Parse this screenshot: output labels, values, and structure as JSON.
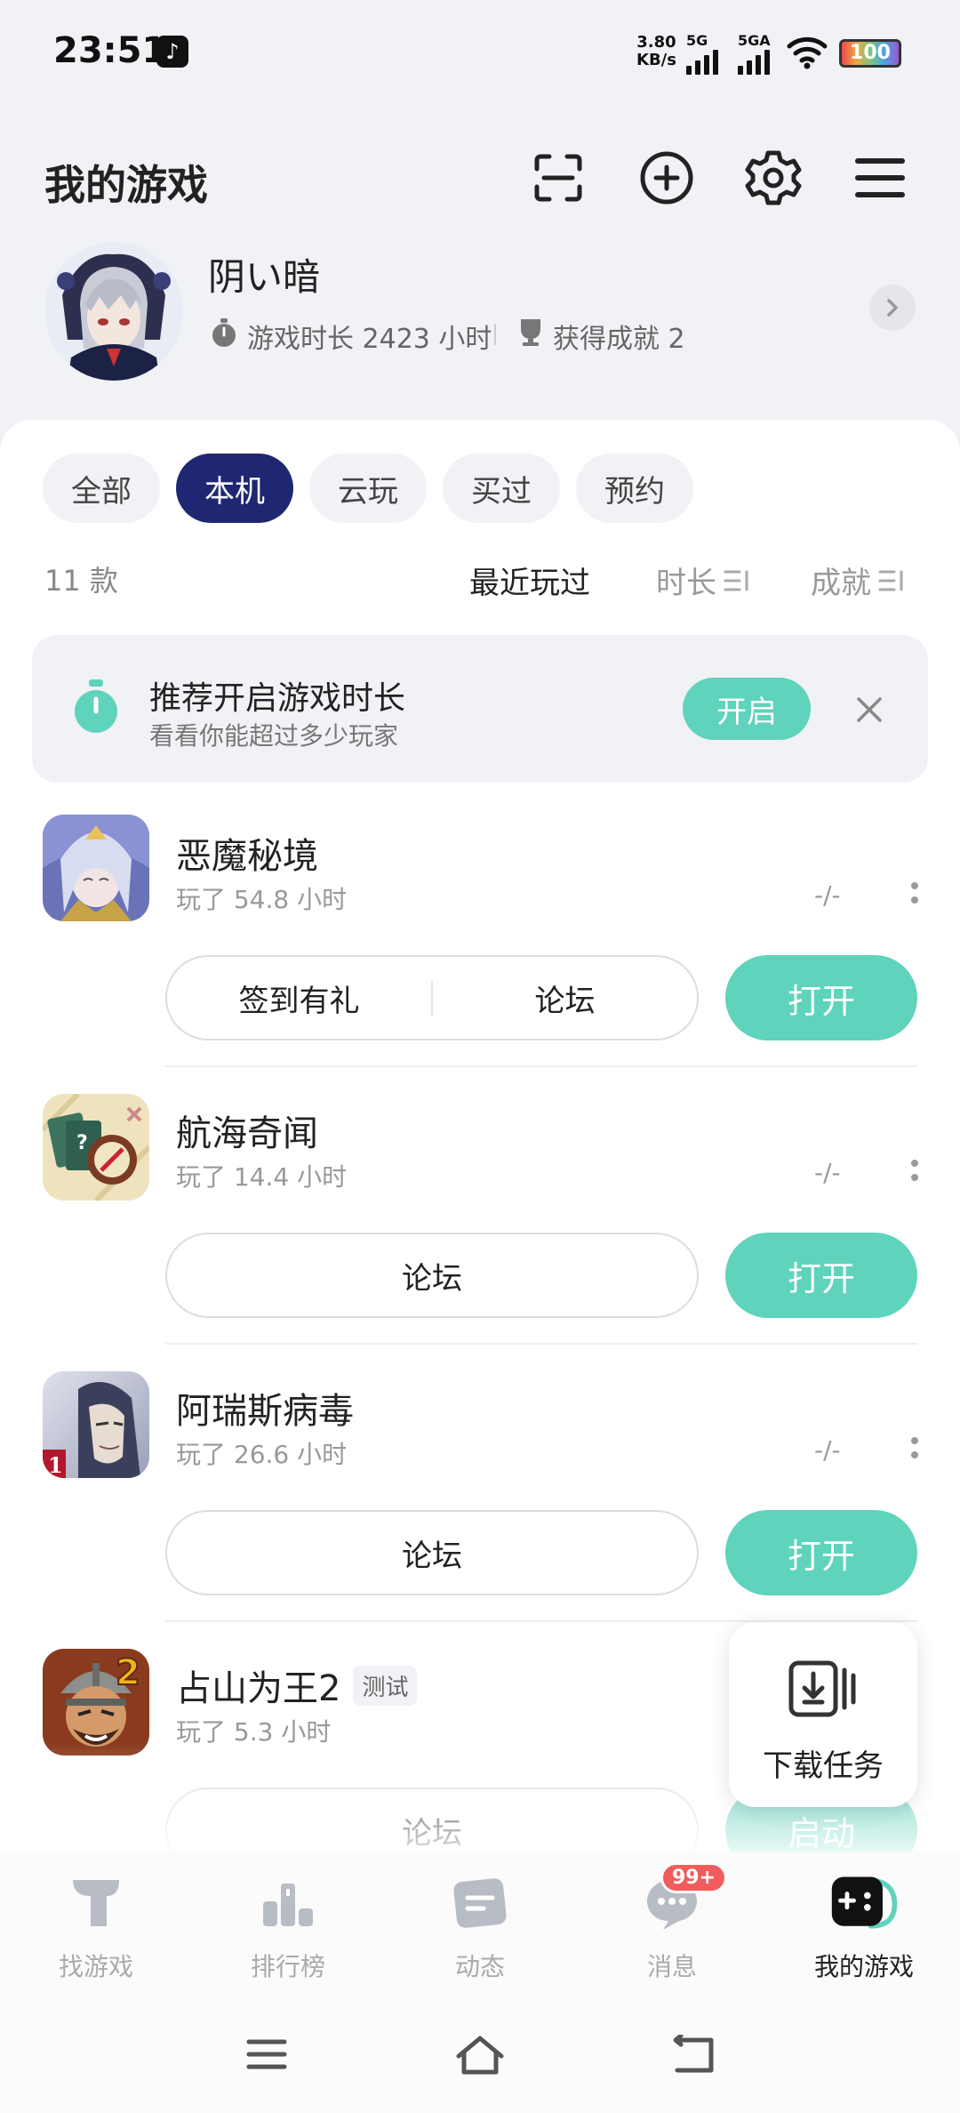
{
  "status_bar": {
    "time": "23:51",
    "net_speed_value": "3.80",
    "net_speed_unit": "KB/s",
    "sim1": "5G",
    "sim2": "5GA",
    "battery": "100"
  },
  "header": {
    "title": "我的游戏",
    "icons": [
      "scan-icon",
      "add-circle-icon",
      "settings-icon",
      "menu-icon"
    ]
  },
  "profile": {
    "username": "阴い暗",
    "play_time": "游戏时长 2423 小时",
    "achievements": "获得成就 2"
  },
  "filter_tabs": [
    {
      "label": "全部",
      "active": false
    },
    {
      "label": "本机",
      "active": true
    },
    {
      "label": "云玩",
      "active": false
    },
    {
      "label": "买过",
      "active": false
    },
    {
      "label": "预约",
      "active": false
    }
  ],
  "list_meta": {
    "count": "11 款",
    "sort_options": [
      "最近玩过",
      "时长",
      "成就"
    ],
    "active_sort": "最近玩过"
  },
  "recommend": {
    "title": "推荐开启游戏时长",
    "subtitle": "看看你能超过多少玩家",
    "button": "开启"
  },
  "games": [
    {
      "name": "恶魔秘境",
      "played": "玩了 54.8 小时",
      "achievement": "-/-",
      "actions": [
        "签到有礼",
        "论坛"
      ],
      "primary": "打开",
      "tag": ""
    },
    {
      "name": "航海奇闻",
      "played": "玩了 14.4 小时",
      "achievement": "-/-",
      "actions": [
        "论坛"
      ],
      "primary": "打开",
      "tag": ""
    },
    {
      "name": "阿瑞斯病毒",
      "played": "玩了 26.6 小时",
      "achievement": "-/-",
      "actions": [
        "论坛"
      ],
      "primary": "打开",
      "tag": ""
    },
    {
      "name": "占山为王2",
      "played": "玩了 5.3 小时",
      "achievement": "",
      "actions": [
        "论坛"
      ],
      "primary": "启动",
      "tag": "测试"
    }
  ],
  "download_task": {
    "label": "下载任务"
  },
  "bottom_nav": [
    {
      "label": "找游戏",
      "icon": "find-games-icon",
      "active": false
    },
    {
      "label": "排行榜",
      "icon": "ranking-icon",
      "active": false
    },
    {
      "label": "动态",
      "icon": "feed-icon",
      "active": false
    },
    {
      "label": "消息",
      "icon": "message-icon",
      "active": false,
      "badge": "99+"
    },
    {
      "label": "我的游戏",
      "icon": "my-games-icon",
      "active": true
    }
  ],
  "colors": {
    "accent": "#5fd3bc",
    "active_tab": "#1f2772",
    "badge": "#f25c5c"
  }
}
